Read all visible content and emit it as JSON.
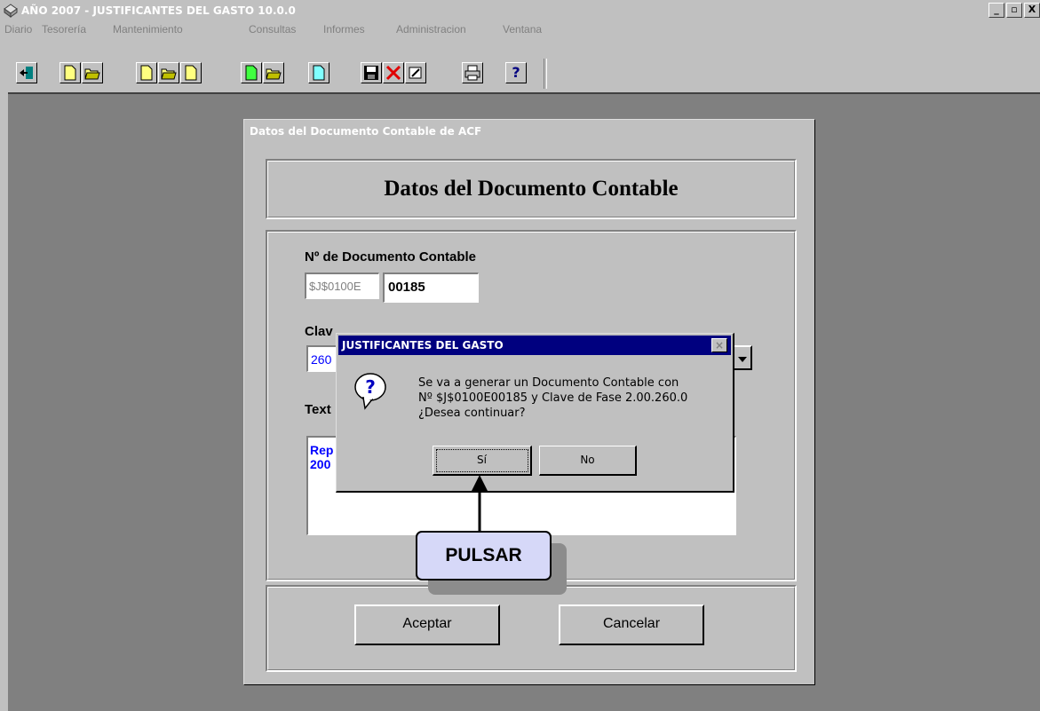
{
  "window": {
    "title": "AÑO 2007 - JUSTIFICANTES DEL GASTO 10.0.0",
    "controls": [
      "_",
      "▫",
      "X"
    ]
  },
  "menu": [
    "Diario",
    "Tesorería",
    "Mantenimiento",
    "Consultas",
    "Informes",
    "Administracion",
    "Ventana"
  ],
  "toolbar": {
    "buttons": [
      "exit-icon",
      "new-doc-icon",
      "open-folder-icon",
      "new-doc-icon",
      "open-folder-icon",
      "new-doc-icon",
      "new-doc-green-icon",
      "open-folder-icon",
      "new-doc-cyan-icon",
      "save-icon",
      "delete-icon",
      "edit-icon",
      "print-icon",
      "help-icon"
    ],
    "help_label": "?"
  },
  "form": {
    "title": "Datos del Documento Contable de ACF",
    "header": "Datos del Documento Contable",
    "doc_label": "Nº de Documento Contable",
    "doc_prefix": "$J$0100E",
    "doc_number": "00185",
    "clave_label": "Clav",
    "clave_value": "260",
    "texto_label": "Text",
    "texto_line1": "Rep",
    "texto_line2": "200",
    "accept_label": "Aceptar",
    "cancel_label": "Cancelar"
  },
  "dialog": {
    "title": "JUSTIFICANTES DEL GASTO",
    "icon": "question-icon",
    "line1": "Se va a generar un Documento Contable con",
    "line2": "Nº $J$0100E00185 y Clave de Fase 2.00.260.0",
    "line3": "¿Desea continuar?",
    "yes_label": "Sí",
    "no_label": "No",
    "close_label": "×"
  },
  "annotation": {
    "label": "PULSAR"
  },
  "colors": {
    "dialog_title_bg": "#00007f",
    "callout_bg": "#d6d8f8",
    "text_blue": "#0000ff",
    "workspace": "#808080",
    "face": "#c0c0c0"
  }
}
